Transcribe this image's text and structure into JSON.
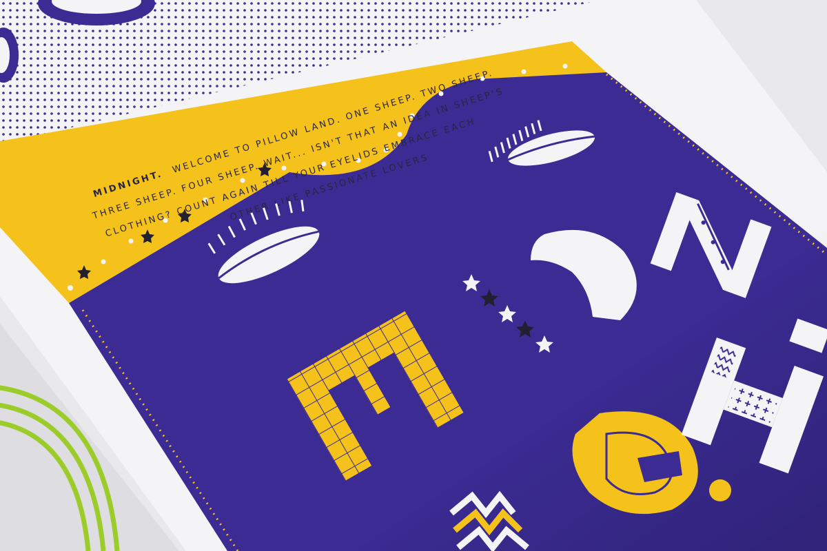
{
  "poster": {
    "text": {
      "lead": "MIDNIGHT.",
      "line1": "WELCOME TO PILLOW LAND. ONE SHEEP. TWO SHEEP.",
      "line2": "THREE SHEEP. FOUR SHEEP. WAIT... ISN'T THAT AN IDEA IN SHEEP'S",
      "line3": "CLOTHING? COUNT AGAIN TILL YOUR EYELIDS EMBRACE EACH",
      "line4": "OTHER LIKE PASSIONATE LOVERS"
    },
    "colors": {
      "yellow": "#f5c21b",
      "purple": "#3b2b93",
      "white": "#f4f4f6",
      "ink": "#222030",
      "green": "#9ccc2a",
      "paper": "#e9e9ec"
    },
    "icons": [
      "closed-eye-icon",
      "moon-icon",
      "star-icon",
      "zigzag-icon"
    ]
  }
}
